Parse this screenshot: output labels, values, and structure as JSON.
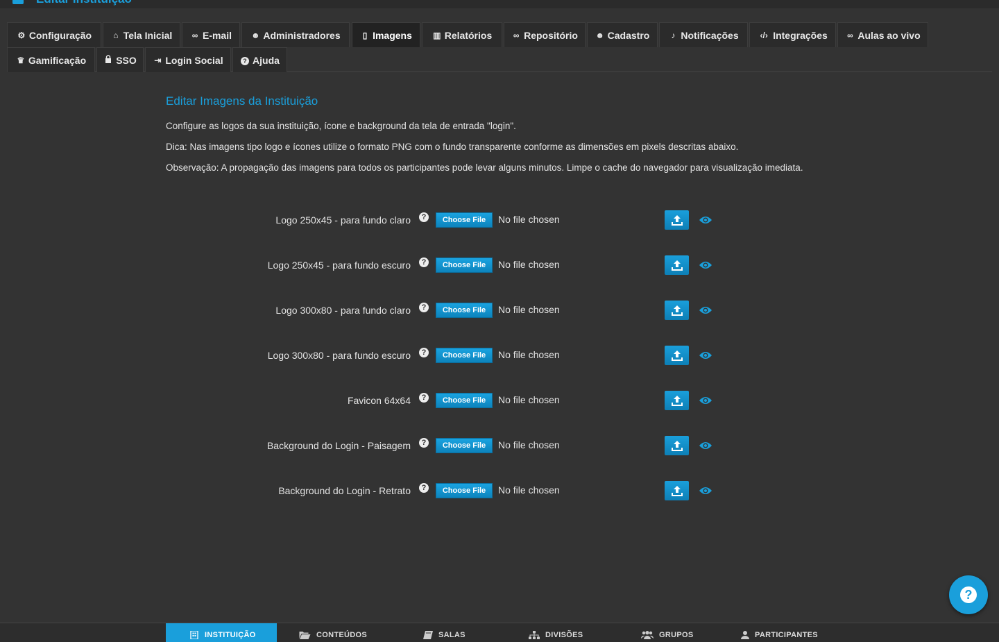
{
  "window": {
    "title": "Editar Instituição",
    "accent": "#1a9fdb"
  },
  "tabs": [
    {
      "label": "Configuração",
      "icon": "cogs-icon",
      "glyph": "⚙"
    },
    {
      "label": "Tela Inicial",
      "icon": "home-icon",
      "glyph": "⌂"
    },
    {
      "label": "E-mail",
      "icon": "link-icon",
      "glyph": "∞"
    },
    {
      "label": "Administradores",
      "icon": "users-icon",
      "glyph": "☻"
    },
    {
      "label": "Imagens",
      "icon": "file-icon",
      "glyph": "▯"
    },
    {
      "label": "Relatórios",
      "icon": "bar-chart-icon",
      "glyph": "▥"
    },
    {
      "label": "Repositório",
      "icon": "link-icon",
      "glyph": "∞"
    },
    {
      "label": "Cadastro",
      "icon": "user-icon",
      "glyph": "☻"
    },
    {
      "label": "Notificações",
      "icon": "bell-icon",
      "glyph": "♪"
    },
    {
      "label": "Integrações",
      "icon": "code-icon",
      "glyph": "‹/›"
    },
    {
      "label": "Aulas ao vivo",
      "icon": "link-icon",
      "glyph": "∞"
    },
    {
      "label": "Gamificação",
      "icon": "trophy-icon",
      "glyph": "♛"
    },
    {
      "label": "SSO",
      "icon": "lock-icon",
      "glyph": "🔒"
    },
    {
      "label": "Login Social",
      "icon": "sign-in-icon",
      "glyph": "⇥"
    },
    {
      "label": "Ajuda",
      "icon": "question-circle-icon",
      "glyph": "?"
    }
  ],
  "active_tab": "Imagens",
  "main": {
    "heading": "Editar Imagens da Instituição",
    "intro": "Configure as logos da sua instituição, ícone e background da tela de entrada \"login\".",
    "tip": "Dica: Nas imagens tipo logo e ícones utilize o formato PNG com o fundo transparente conforme as dimensões em pixels descritas abaixo.",
    "note": "Observação: A propagação das imagens para todos os participantes pode levar alguns minutos. Limpe o cache do navegador para visualização imediata."
  },
  "upload_rows": [
    {
      "label": "Logo 250x45 - para fundo claro",
      "button": "Choose File",
      "status": "No file chosen"
    },
    {
      "label": "Logo 250x45 - para fundo escuro",
      "button": "Choose File",
      "status": "No file chosen"
    },
    {
      "label": "Logo 300x80 - para fundo claro",
      "button": "Choose File",
      "status": "No file chosen"
    },
    {
      "label": "Logo 300x80 - para fundo escuro",
      "button": "Choose File",
      "status": "No file chosen"
    },
    {
      "label": "Favicon 64x64",
      "button": "Choose File",
      "status": "No file chosen"
    },
    {
      "label": "Background do Login - Paisagem",
      "button": "Choose File",
      "status": "No file chosen"
    },
    {
      "label": "Background do Login - Retrato",
      "button": "Choose File",
      "status": "No file chosen"
    }
  ],
  "bottom_nav": [
    {
      "label": "INSTITUIÇÃO",
      "icon": "building-icon",
      "active": true
    },
    {
      "label": "CONTEÚDOS",
      "icon": "folder-open-icon",
      "active": false
    },
    {
      "label": "SALAS",
      "icon": "book-icon",
      "active": false
    },
    {
      "label": "DIVISÕES",
      "icon": "sitemap-icon",
      "active": false
    },
    {
      "label": "GRUPOS",
      "icon": "users-icon",
      "active": false
    },
    {
      "label": "PARTICIPANTES",
      "icon": "user-icon",
      "active": false
    }
  ],
  "help_fab": {
    "icon": "question-circle-icon"
  }
}
